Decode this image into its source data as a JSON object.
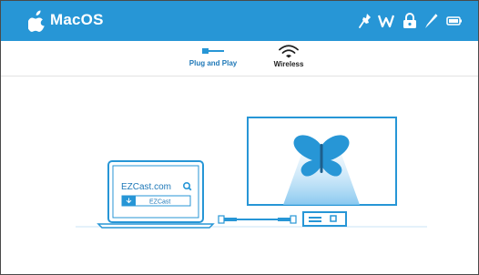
{
  "header": {
    "os_title": "MacOS",
    "bar_color": "#2796d6",
    "icons": [
      "apple-logo",
      "pin-icon",
      "wifi-w-icon",
      "lock-cloud-icon",
      "pencil-icon",
      "battery-icon"
    ]
  },
  "tabs": [
    {
      "label": "Plug and Play",
      "icon": "cable-icon",
      "active": true
    },
    {
      "label": "Wireless",
      "icon": "wifi-icon",
      "active": false
    }
  ],
  "illustration": {
    "laptop_site": "EZCast.com",
    "laptop_button": "EZCast",
    "accent_color": "#2796d6"
  }
}
